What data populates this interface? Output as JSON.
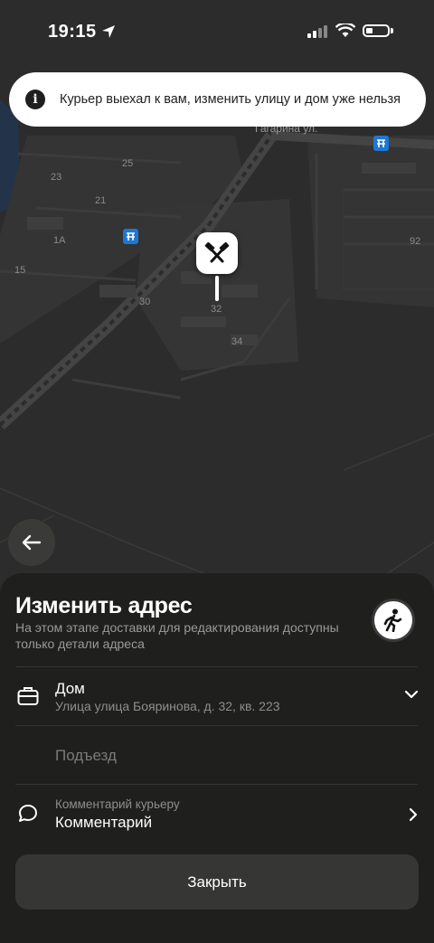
{
  "status_bar": {
    "time": "19:15"
  },
  "toast": {
    "icon": "i",
    "text": "Курьер выехал к вам, изменить улицу и дом уже нельзя"
  },
  "map": {
    "street_label": "Гагарина ул.",
    "house_numbers": [
      "23",
      "25",
      "21",
      "1A",
      "15",
      "30",
      "32",
      "34",
      "92"
    ]
  },
  "sheet": {
    "title": "Изменить адрес",
    "subtitle": "На этом этапе доставки для редактирования доступны только детали адреса",
    "address": {
      "label": "Дом",
      "value": "Улица улица Бояринова, д. 32, кв. 223"
    },
    "entrance_placeholder": "Подъезд",
    "comment": {
      "label": "Комментарий курьеру",
      "value": "Комментарий"
    },
    "close_label": "Закрыть"
  },
  "colors": {
    "background": "#2b2c2b",
    "sheet": "#1f1f1e",
    "button": "#363635",
    "transit_icon": "#1f77d4"
  }
}
